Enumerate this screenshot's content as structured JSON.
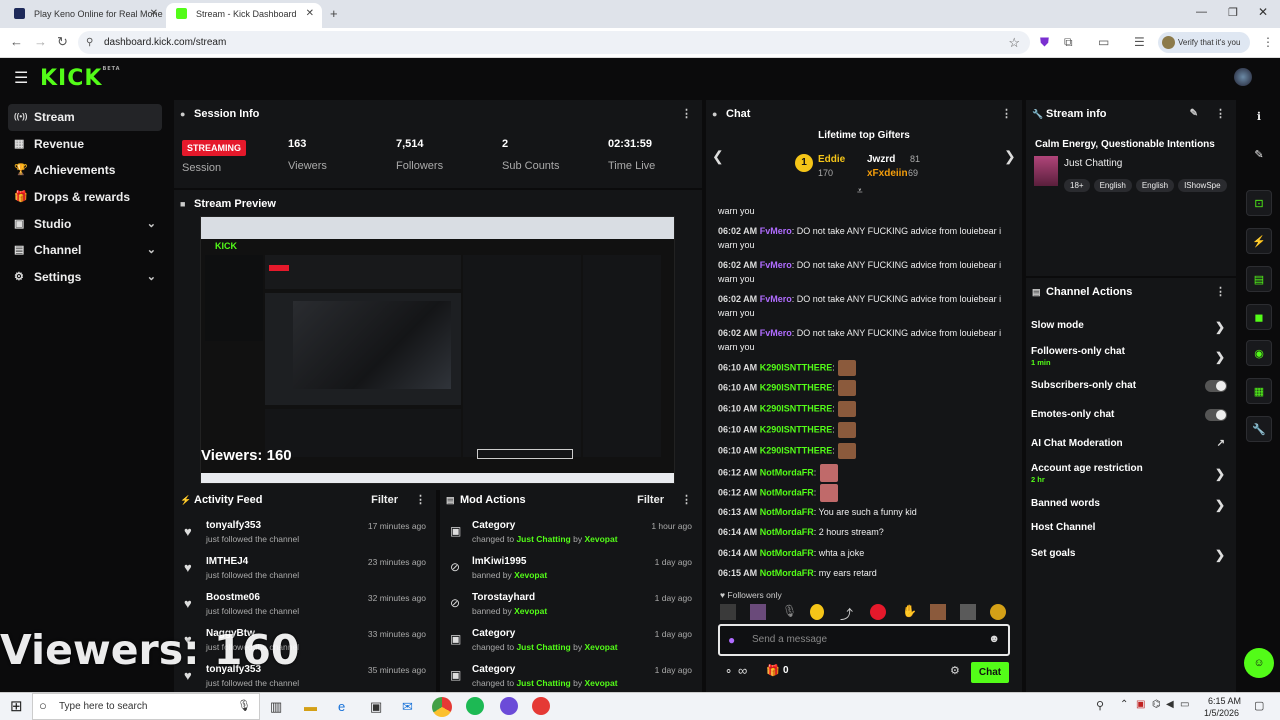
{
  "browser": {
    "tabs": [
      {
        "label": "Play Keno Online for Real Mone",
        "fav_color": "#1e2a5a"
      },
      {
        "label": "Stream - Kick Dashboard",
        "fav_color": "#53fc18"
      }
    ],
    "url": "dashboard.kick.com/stream",
    "verify_label": "Verify that it's you"
  },
  "app": {
    "logo": "KICK",
    "logo_badge": "BETA"
  },
  "sidebar": {
    "items": [
      {
        "label": "Stream",
        "icon": "broadcast-icon",
        "glyph": "((•))",
        "active": true,
        "chevron": false
      },
      {
        "label": "Revenue",
        "icon": "revenue-icon",
        "glyph": "▦",
        "active": false,
        "chevron": false
      },
      {
        "label": "Achievements",
        "icon": "trophy-icon",
        "glyph": "🏆",
        "active": false,
        "chevron": false
      },
      {
        "label": "Drops & rewards",
        "icon": "gift-icon",
        "glyph": "🎁",
        "active": false,
        "chevron": false
      },
      {
        "label": "Studio",
        "icon": "studio-icon",
        "glyph": "▣",
        "active": false,
        "chevron": true
      },
      {
        "label": "Channel",
        "icon": "channel-icon",
        "glyph": "▤",
        "active": false,
        "chevron": true
      },
      {
        "label": "Settings",
        "icon": "gear-icon",
        "glyph": "⚙",
        "active": false,
        "chevron": true
      }
    ]
  },
  "session": {
    "title": "Session Info",
    "status": "STREAMING",
    "status_label": "Session",
    "stats": [
      {
        "value": "163",
        "label": "Viewers"
      },
      {
        "value": "7,514",
        "label": "Followers"
      },
      {
        "value": "2",
        "label": "Sub Counts"
      },
      {
        "value": "02:31:59",
        "label": "Time Live"
      }
    ]
  },
  "preview": {
    "title": "Stream Preview",
    "viewers_text": "Viewers: 160"
  },
  "activity": {
    "title": "Activity Feed",
    "filter": "Filter",
    "rows": [
      {
        "name": "tonyalfy353",
        "sub": "just followed the channel",
        "time": "17 minutes ago"
      },
      {
        "name": "IMTHEJ4",
        "sub": "just followed the channel",
        "time": "23 minutes ago"
      },
      {
        "name": "Boostme06",
        "sub": "just followed the channel",
        "time": "32 minutes ago"
      },
      {
        "name": "NaggyBtw",
        "sub": "just followed the channel",
        "time": "33 minutes ago"
      },
      {
        "name": "tonyalfy353",
        "sub": "just followed the channel",
        "time": "35 minutes ago"
      }
    ]
  },
  "mod_actions": {
    "title": "Mod Actions",
    "filter": "Filter",
    "rows": [
      {
        "name": "Category",
        "pre": "changed to ",
        "hl": "Just Chatting",
        "mid": " by ",
        "by": "Xevopat",
        "time": "1 hour ago",
        "icon": "category-icon",
        "glyph": "▣"
      },
      {
        "name": "lmKiwi1995",
        "pre": "banned by ",
        "hl": "",
        "mid": "",
        "by": "Xevopat",
        "time": "1 day ago",
        "icon": "ban-icon",
        "glyph": "⊘"
      },
      {
        "name": "Torostayhard",
        "pre": "banned by ",
        "hl": "",
        "mid": "",
        "by": "Xevopat",
        "time": "1 day ago",
        "icon": "ban-icon",
        "glyph": "⊘"
      },
      {
        "name": "Category",
        "pre": "changed to ",
        "hl": "Just Chatting",
        "mid": " by ",
        "by": "Xevopat",
        "time": "1 day ago",
        "icon": "category-icon",
        "glyph": "▣"
      },
      {
        "name": "Category",
        "pre": "changed to ",
        "hl": "Just Chatting",
        "mid": " by ",
        "by": "Xevopat",
        "time": "1 day ago",
        "icon": "category-icon",
        "glyph": "▣"
      }
    ]
  },
  "chat": {
    "title": "Chat",
    "gifters_title": "Lifetime top Gifters",
    "gifters": [
      {
        "name": "Eddie",
        "count": "170"
      },
      {
        "name": "Jwzrd",
        "count": "81"
      },
      {
        "name": "xFxdeiin",
        "count": "69"
      }
    ],
    "top_fragment": "warn you",
    "messages": [
      {
        "time": "06:02 AM",
        "user": "FvMero",
        "style": "u1",
        "text": "DO not take ANY FUCKING advice from louiebear i warn you",
        "emotes": 0
      },
      {
        "time": "06:02 AM",
        "user": "FvMero",
        "style": "u1",
        "text": "DO not take ANY FUCKING advice from louiebear i warn you",
        "emotes": 0
      },
      {
        "time": "06:02 AM",
        "user": "FvMero",
        "style": "u1",
        "text": "DO not take ANY FUCKING advice from louiebear i warn you",
        "emotes": 0
      },
      {
        "time": "06:02 AM",
        "user": "FvMero",
        "style": "u1",
        "text": "DO not take ANY FUCKING advice from louiebear i warn you",
        "emotes": 0
      },
      {
        "time": "06:10 AM",
        "user": "K290ISNTTHERE",
        "style": "u2",
        "text": "",
        "emotes": 1
      },
      {
        "time": "06:10 AM",
        "user": "K290ISNTTHERE",
        "style": "u2",
        "text": "",
        "emotes": 1
      },
      {
        "time": "06:10 AM",
        "user": "K290ISNTTHERE",
        "style": "u2",
        "text": "",
        "emotes": 1
      },
      {
        "time": "06:10 AM",
        "user": "K290ISNTTHERE",
        "style": "u2",
        "text": "",
        "emotes": 1
      },
      {
        "time": "06:10 AM",
        "user": "K290ISNTTHERE",
        "style": "u2",
        "text": "",
        "emotes": 1
      },
      {
        "time": "06:12 AM",
        "user": "NotMordaFR",
        "style": "u2",
        "text": "",
        "emotes": 2
      },
      {
        "time": "06:12 AM",
        "user": "NotMordaFR",
        "style": "u2",
        "text": "",
        "emotes": 2
      },
      {
        "time": "06:13 AM",
        "user": "NotMordaFR",
        "style": "u2",
        "text": "You are such a funny kid",
        "emotes": 0
      },
      {
        "time": "06:14 AM",
        "user": "NotMordaFR",
        "style": "u2",
        "text": "2 hours stream?",
        "emotes": 0
      },
      {
        "time": "06:14 AM",
        "user": "NotMordaFR",
        "style": "u2",
        "text": "whta a joke",
        "emotes": 0
      },
      {
        "time": "06:15 AM",
        "user": "NotMordaFR",
        "style": "u2",
        "text": "my ears retard",
        "emotes": 0
      }
    ],
    "followers_only": "Followers only",
    "input_placeholder": "Send a message",
    "infinity": "∞",
    "count": "0",
    "send_label": "Chat"
  },
  "stream_info": {
    "title": "Stream info",
    "stream_title": "Calm Energy, Questionable Intentions",
    "category": "Just Chatting",
    "tags": [
      "18+",
      "English",
      "English",
      "IShowSpe"
    ]
  },
  "channel_actions": {
    "title": "Channel Actions",
    "rows": [
      {
        "label": "Slow mode",
        "sub": "",
        "control": "arrow"
      },
      {
        "label": "Followers-only chat",
        "sub": "1 min",
        "control": "arrow"
      },
      {
        "label": "Subscribers-only chat",
        "sub": "",
        "control": "toggle"
      },
      {
        "label": "Emotes-only chat",
        "sub": "",
        "control": "toggle"
      },
      {
        "label": "AI Chat Moderation",
        "sub": "",
        "control": "external"
      },
      {
        "label": "Account age restriction",
        "sub": "2 hr",
        "control": "arrow"
      },
      {
        "label": "Banned words",
        "sub": "",
        "control": "arrow"
      },
      {
        "label": "Host Channel",
        "sub": "",
        "control": "none"
      },
      {
        "label": "Set goals",
        "sub": "",
        "control": "arrow"
      }
    ]
  },
  "overlay": {
    "viewers_text": "Viewers: 160"
  },
  "taskbar": {
    "search_placeholder": "Type here to search",
    "time": "6:15 AM",
    "date": "1/5/2026"
  },
  "colors": {
    "accent": "#53fc18",
    "streaming": "#e5192b",
    "panel": "#141517"
  }
}
